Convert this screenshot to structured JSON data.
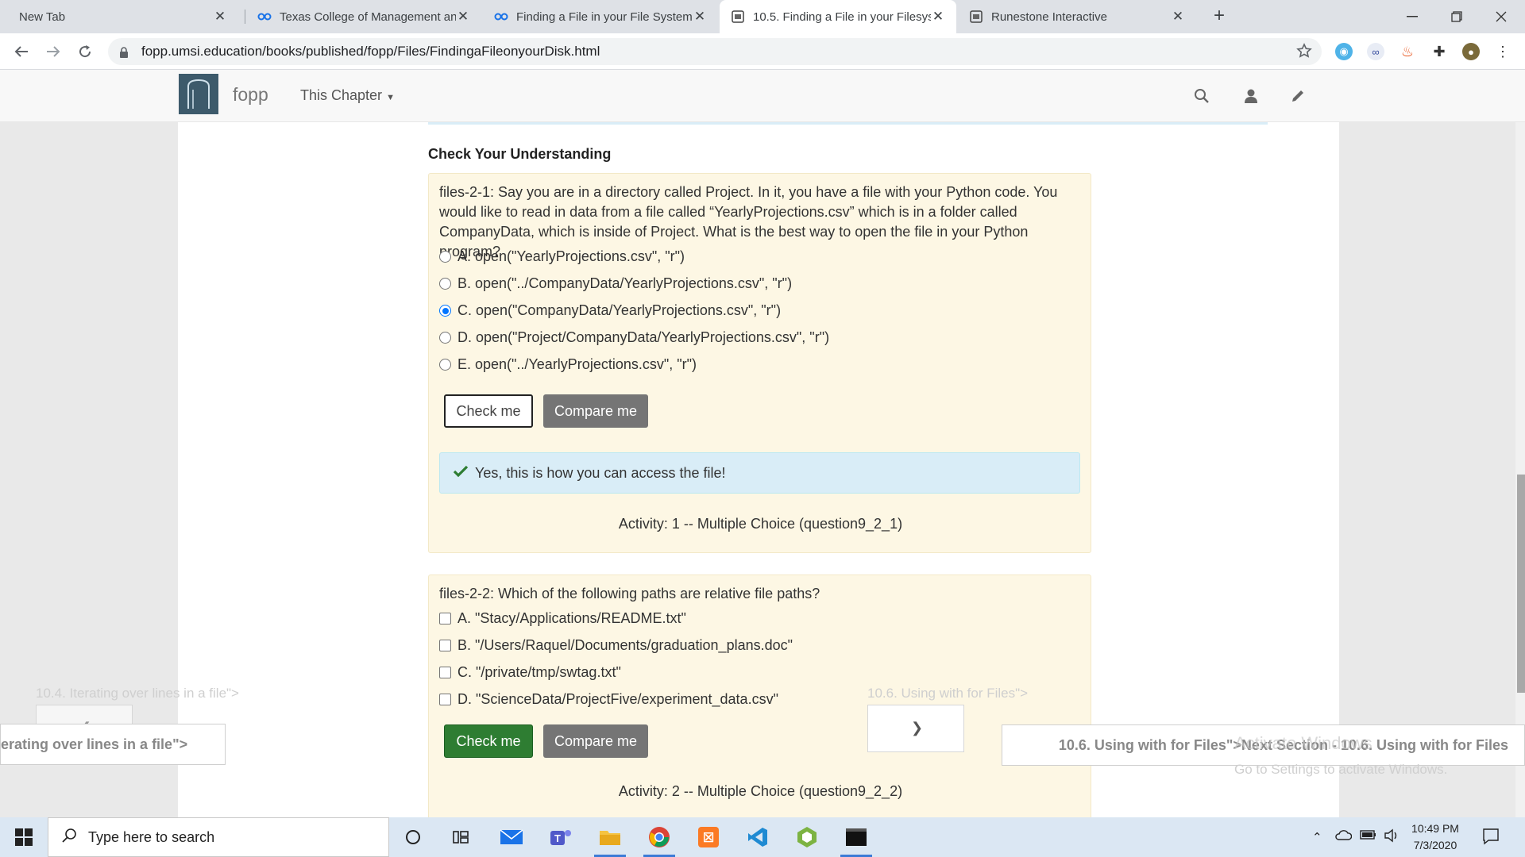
{
  "browser": {
    "tabs": [
      {
        "title": "New Tab",
        "active": false
      },
      {
        "title": "Texas College of Management an",
        "active": false
      },
      {
        "title": "Finding a File in your File System",
        "active": false
      },
      {
        "title": "10.5. Finding a File in your Filesys",
        "active": true
      },
      {
        "title": "Runestone Interactive",
        "active": false
      }
    ],
    "new_tab_label": "+",
    "url": "fopp.umsi.education/books/published/fopp/Files/FindingaFileonyourDisk.html"
  },
  "site": {
    "brand": "fopp",
    "chapter_menu": "This Chapter"
  },
  "section_title": "Check Your Understanding",
  "questions": [
    {
      "prompt": "files-2-1: Say you are in a directory called Project. In it, you have a file with your Python code. You would like to read in data from a file called “YearlyProjections.csv” which is in a folder called CompanyData, which is inside of Project. What is the best way to open the file in your Python program?",
      "options": [
        {
          "label": "A. open(\"YearlyProjections.csv\", \"r\")",
          "checked": false
        },
        {
          "label": "B. open(\"../CompanyData/YearlyProjections.csv\", \"r\")",
          "checked": false
        },
        {
          "label": "C. open(\"CompanyData/YearlyProjections.csv\", \"r\")",
          "checked": true
        },
        {
          "label": "D. open(\"Project/CompanyData/YearlyProjections.csv\", \"r\")",
          "checked": false
        },
        {
          "label": "E. open(\"../YearlyProjections.csv\", \"r\")",
          "checked": false
        }
      ],
      "check_label": "Check me",
      "compare_label": "Compare me",
      "feedback": "Yes, this is how you can access the file!",
      "activity": "Activity: 1 -- Multiple Choice (question9_2_1)"
    },
    {
      "prompt": "files-2-2: Which of the following paths are relative file paths?",
      "options": [
        {
          "label": "A. \"Stacy/Applications/README.txt\"",
          "checked": false
        },
        {
          "label": "B. \"/Users/Raquel/Documents/graduation_plans.doc\"",
          "checked": false
        },
        {
          "label": "C. \"/private/tmp/swtag.txt\"",
          "checked": false
        },
        {
          "label": "D. \"ScienceData/ProjectFive/experiment_data.csv\"",
          "checked": false
        }
      ],
      "check_label": "Check me",
      "compare_label": "Compare me",
      "activity": "Activity: 2 -- Multiple Choice (question9_2_2)"
    }
  ],
  "pager": {
    "prev_ghost": "10.4. Iterating over lines in a file\">",
    "next_ghost": "10.6. Using with for Files\">",
    "prev_link": "erating over lines in a file\">",
    "next_link": "10.6. Using with for Files\">Next Section - 10.6. Using with for Files"
  },
  "watermark": {
    "line1": "Activate Windows",
    "line2": "Go to Settings to activate Windows."
  },
  "taskbar": {
    "search_placeholder": "Type here to search",
    "time": "10:49 PM",
    "date": "7/3/2020"
  },
  "colors": {
    "correct": "#2e7d32",
    "feedback_bg": "#d9edf7",
    "question_bg": "#fdf7e4",
    "radio_accent": "#0075ff"
  }
}
